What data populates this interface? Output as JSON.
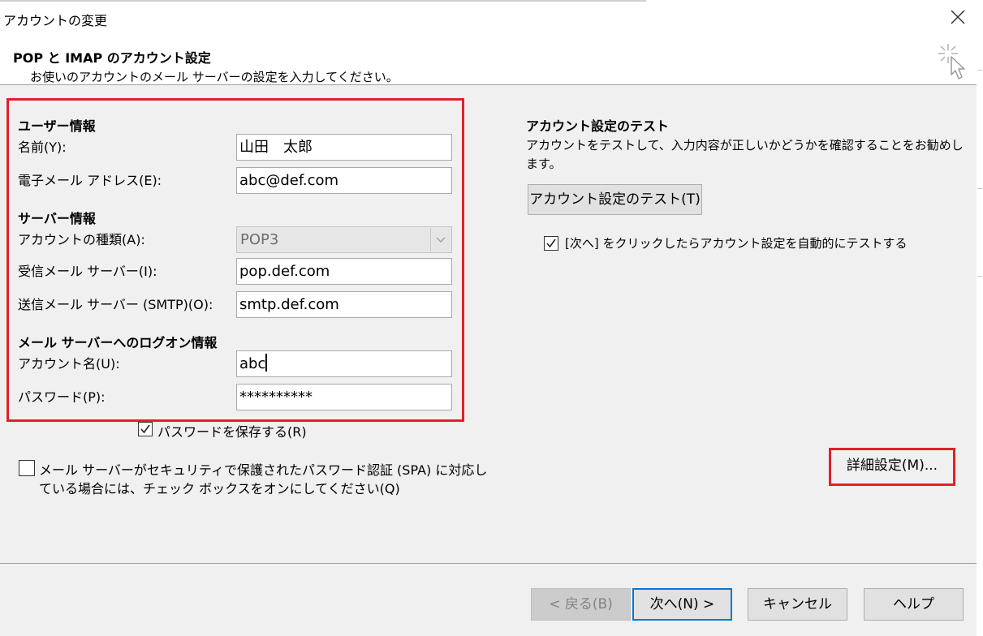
{
  "window": {
    "title": "アカウントの変更",
    "close_icon": "close-icon"
  },
  "header": {
    "title": "POP と IMAP のアカウント設定",
    "subtitle": "お使いのアカウントのメール サーバーの設定を入力してください。",
    "icon": "cursor-sparkle-icon"
  },
  "user_info": {
    "section_title": "ユーザー情報",
    "name_label": "名前(Y):",
    "name_value": "山田　太郎",
    "email_label": "電子メール アドレス(E):",
    "email_value": "abc@def.com"
  },
  "server_info": {
    "section_title": "サーバー情報",
    "account_type_label": "アカウントの種類(A):",
    "account_type_value": "POP3",
    "incoming_label": "受信メール サーバー(I):",
    "incoming_value": "pop.def.com",
    "outgoing_label": "送信メール サーバー (SMTP)(O):",
    "outgoing_value": "smtp.def.com"
  },
  "logon_info": {
    "section_title": "メール サーバーへのログオン情報",
    "account_name_label": "アカウント名(U):",
    "account_name_value": "abc",
    "password_label": "パスワード(P):",
    "password_value": "**********"
  },
  "options": {
    "save_password_label": "パスワードを保存する(R)",
    "save_password_checked": true,
    "spa_label_line1": "メール サーバーがセキュリティで保護されたパスワード認証 (SPA) に対応し",
    "spa_label_line2": "ている場合には、チェック ボックスをオンにしてください(Q)",
    "spa_checked": false
  },
  "test": {
    "section_title": "アカウント設定のテスト",
    "description_line1": "アカウントをテストして、入力内容が正しいかどうかを確認することをお勧めし",
    "description_line2": "ます。",
    "test_button_label": "アカウント設定のテスト(T)",
    "auto_test_label": "[次へ] をクリックしたらアカウント設定を自動的にテストする",
    "auto_test_checked": true
  },
  "advanced_button_label": "詳細設定(M)...",
  "footer": {
    "back_label": "< 戻る(B)",
    "next_label": "次へ(N) >",
    "cancel_label": "キャンセル",
    "help_label": "ヘルプ"
  },
  "colors": {
    "highlight_red": "#e2202a",
    "focus_blue": "#0078d7",
    "dialog_bg": "#f0f0f0"
  }
}
